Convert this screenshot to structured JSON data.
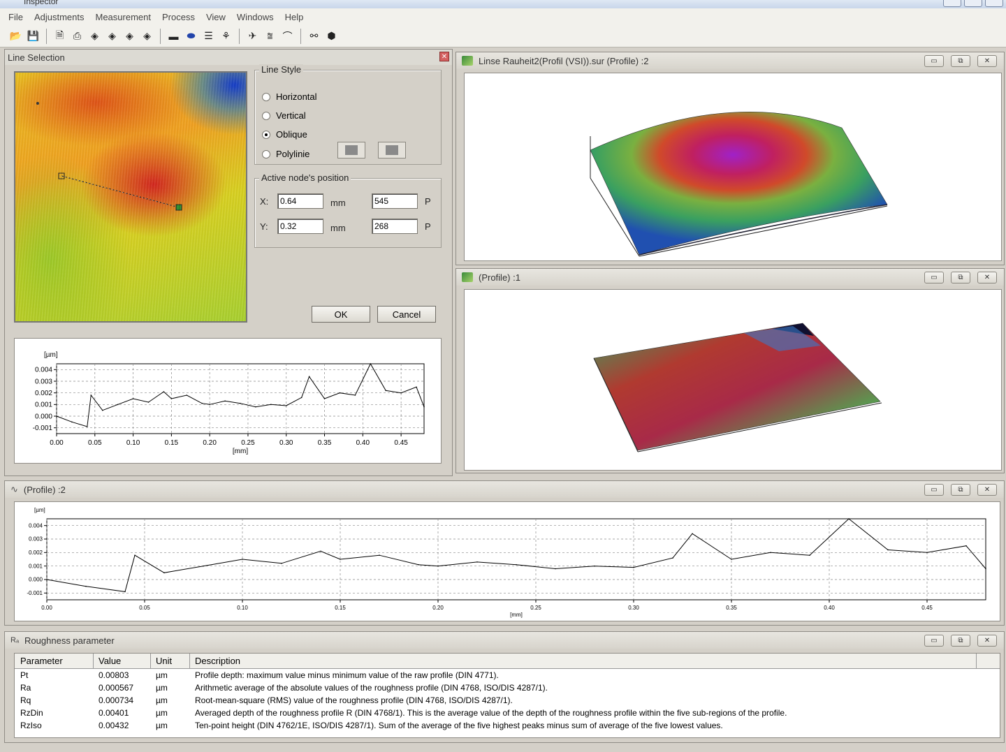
{
  "app": {
    "title": "Inspector"
  },
  "menu": [
    "File",
    "Adjustments",
    "Measurement",
    "Process",
    "View",
    "Windows",
    "Help"
  ],
  "toolbar_icons": [
    "open-folder-icon",
    "save-icon",
    "print-preview-icon",
    "print-icon",
    "layer-icon",
    "layer-icon",
    "layer-icon",
    "layer-icon",
    "bar-icon",
    "ellipse-icon",
    "list-icon",
    "tree-icon",
    "pointer-icon",
    "profile-icon",
    "arc-icon",
    "fork-icon",
    "stack-icon"
  ],
  "line_selection": {
    "title": "Line Selection",
    "line_style": {
      "label": "Line Style",
      "options": [
        "Horizontal",
        "Vertical",
        "Oblique",
        "Polylinie"
      ],
      "selected": "Oblique"
    },
    "node": {
      "label": "Active node's position",
      "x_label": "X:",
      "x_value": "0.64",
      "x_unit": "mm",
      "x_pixel": "545",
      "x_pixel_unit": "P",
      "y_label": "Y:",
      "y_value": "0.32",
      "y_unit": "mm",
      "y_pixel": "268",
      "y_pixel_unit": "P"
    },
    "ok": "OK",
    "cancel": "Cancel"
  },
  "windows": {
    "view3d_top": {
      "title": "Linse Rauheit2(Profil (VSI)).sur (Profile) :2"
    },
    "view3d_bottom": {
      "title": "(Profile) :1"
    },
    "profile_window": {
      "title": "(Profile) :2"
    },
    "roughness": {
      "title": "Roughness parameter"
    }
  },
  "chart_data": [
    {
      "type": "line",
      "ylabel": "[µm]",
      "xlabel": "[mm]",
      "xlim": [
        0,
        0.48
      ],
      "ylim": [
        -0.0015,
        0.0045
      ],
      "x_ticks": [
        "0.00",
        "0.05",
        "0.10",
        "0.15",
        "0.20",
        "0.25",
        "0.30",
        "0.35",
        "0.40",
        "0.45"
      ],
      "y_ticks": [
        "0.004",
        "0.003",
        "0.002",
        "0.001",
        "0.000",
        "-0.001"
      ],
      "series": [
        {
          "x": [
            0.0,
            0.02,
            0.04,
            0.045,
            0.06,
            0.08,
            0.1,
            0.12,
            0.14,
            0.15,
            0.17,
            0.19,
            0.2,
            0.22,
            0.24,
            0.26,
            0.28,
            0.3,
            0.32,
            0.33,
            0.35,
            0.37,
            0.39,
            0.41,
            0.43,
            0.45,
            0.47,
            0.48
          ],
          "y": [
            0.0,
            -0.0005,
            -0.0009,
            0.0018,
            0.0005,
            0.001,
            0.0015,
            0.0012,
            0.0021,
            0.0015,
            0.0018,
            0.0011,
            0.001,
            0.0013,
            0.0011,
            0.0008,
            0.001,
            0.0009,
            0.0016,
            0.0034,
            0.0015,
            0.002,
            0.0018,
            0.0045,
            0.0022,
            0.002,
            0.0025,
            0.0008
          ]
        }
      ]
    },
    {
      "type": "line",
      "ylabel": "[µm]",
      "xlabel": "[mm]",
      "xlim": [
        0,
        0.48
      ],
      "ylim": [
        -0.0015,
        0.0045
      ],
      "x_ticks": [
        "0.00",
        "0.05",
        "0.10",
        "0.15",
        "0.20",
        "0.25",
        "0.30",
        "0.35",
        "0.40",
        "0.45"
      ],
      "y_ticks": [
        "0.004",
        "0.003",
        "0.002",
        "0.001",
        "0.000",
        "-0.001"
      ],
      "series": [
        {
          "x": [
            0.0,
            0.02,
            0.04,
            0.045,
            0.06,
            0.08,
            0.1,
            0.12,
            0.14,
            0.15,
            0.17,
            0.19,
            0.2,
            0.22,
            0.24,
            0.26,
            0.28,
            0.3,
            0.32,
            0.33,
            0.35,
            0.37,
            0.39,
            0.41,
            0.43,
            0.45,
            0.47,
            0.48
          ],
          "y": [
            0.0,
            -0.0005,
            -0.0009,
            0.0018,
            0.0005,
            0.001,
            0.0015,
            0.0012,
            0.0021,
            0.0015,
            0.0018,
            0.0011,
            0.001,
            0.0013,
            0.0011,
            0.0008,
            0.001,
            0.0009,
            0.0016,
            0.0034,
            0.0015,
            0.002,
            0.0018,
            0.0045,
            0.0022,
            0.002,
            0.0025,
            0.0008
          ]
        }
      ]
    }
  ],
  "roughness_table": {
    "headers": [
      "Parameter",
      "Value",
      "Unit",
      "Description"
    ],
    "rows": [
      {
        "param": "Pt",
        "value": "0.00803",
        "unit": "µm",
        "desc": "Profile depth: maximum value minus minimum value of the raw profile (DIN 4771)."
      },
      {
        "param": "Ra",
        "value": "0.000567",
        "unit": "µm",
        "desc": "Arithmetic average of the absolute values of the roughness profile (DIN 4768, ISO/DIS 4287/1)."
      },
      {
        "param": "Rq",
        "value": "0.000734",
        "unit": "µm",
        "desc": "Root-mean-square (RMS) value of the roughness profile (DIN 4768, ISO/DIS 4287/1)."
      },
      {
        "param": "RzDin",
        "value": "0.00401",
        "unit": "µm",
        "desc": "Averaged depth of the roughness profile R (DIN 4768/1). This is the average value of the depth of the roughness profile  within the five sub-regions of the profile."
      },
      {
        "param": "RzIso",
        "value": "0.00432",
        "unit": "µm",
        "desc": "Ten-point height (DIN 4762/1E, ISO/DIS 4287/1). Sum of the average of the five highest peaks minus sum of average of the five lowest values."
      }
    ]
  }
}
